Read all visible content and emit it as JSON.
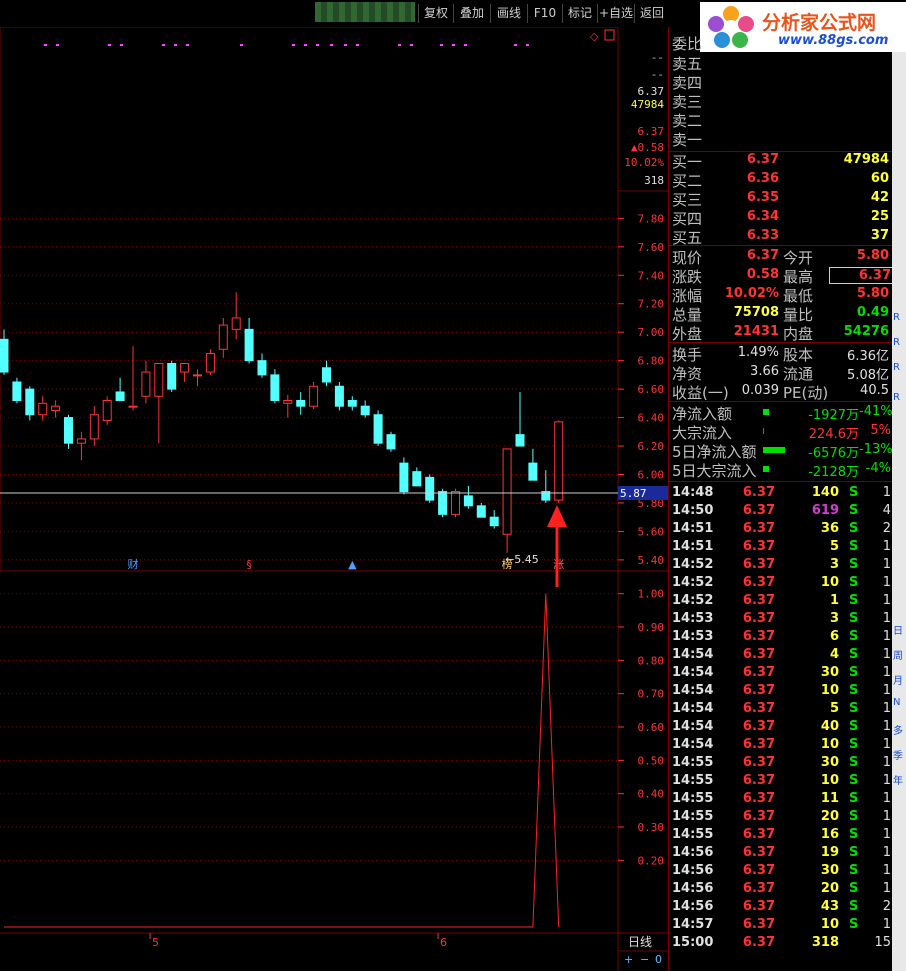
{
  "toolbar": {
    "buttons": [
      "复权",
      "叠加",
      "画线",
      "F10",
      "标记",
      "+自选",
      "返回"
    ]
  },
  "logo": {
    "title": "分析家公式网",
    "url": "www.88gs.com"
  },
  "chart_data": [
    {
      "type": "candlestick",
      "title": "",
      "ylim": [
        5.35,
        7.95
      ],
      "yticks": [
        "7.80",
        "7.60",
        "7.40",
        "7.20",
        "7.00",
        "6.80",
        "6.60",
        "6.40",
        "6.20",
        "6.00",
        "5.80",
        "5.60",
        "5.40"
      ],
      "current_line": "5.87",
      "low_marker": "←5.45",
      "candles": [
        {
          "o": 6.95,
          "h": 7.02,
          "l": 6.7,
          "c": 6.72
        },
        {
          "o": 6.65,
          "h": 6.68,
          "l": 6.5,
          "c": 6.52
        },
        {
          "o": 6.6,
          "h": 6.62,
          "l": 6.38,
          "c": 6.42
        },
        {
          "o": 6.42,
          "h": 6.55,
          "l": 6.38,
          "c": 6.5
        },
        {
          "o": 6.45,
          "h": 6.52,
          "l": 6.4,
          "c": 6.48
        },
        {
          "o": 6.4,
          "h": 6.42,
          "l": 6.18,
          "c": 6.22
        },
        {
          "o": 6.22,
          "h": 6.3,
          "l": 6.1,
          "c": 6.25
        },
        {
          "o": 6.25,
          "h": 6.48,
          "l": 6.2,
          "c": 6.42
        },
        {
          "o": 6.38,
          "h": 6.55,
          "l": 6.35,
          "c": 6.52
        },
        {
          "o": 6.58,
          "h": 6.68,
          "l": 6.52,
          "c": 6.52
        },
        {
          "o": 6.48,
          "h": 6.9,
          "l": 6.45,
          "c": 6.48
        },
        {
          "o": 6.55,
          "h": 6.8,
          "l": 6.5,
          "c": 6.72
        },
        {
          "o": 6.55,
          "h": 6.78,
          "l": 6.22,
          "c": 6.78
        },
        {
          "o": 6.78,
          "h": 6.8,
          "l": 6.58,
          "c": 6.6
        },
        {
          "o": 6.72,
          "h": 6.78,
          "l": 6.65,
          "c": 6.78
        },
        {
          "o": 6.7,
          "h": 6.74,
          "l": 6.62,
          "c": 6.7
        },
        {
          "o": 6.72,
          "h": 6.88,
          "l": 6.7,
          "c": 6.85
        },
        {
          "o": 6.88,
          "h": 7.1,
          "l": 6.82,
          "c": 7.05
        },
        {
          "o": 7.02,
          "h": 7.28,
          "l": 6.95,
          "c": 7.1
        },
        {
          "o": 7.02,
          "h": 7.1,
          "l": 6.78,
          "c": 6.8
        },
        {
          "o": 6.8,
          "h": 6.85,
          "l": 6.68,
          "c": 6.7
        },
        {
          "o": 6.7,
          "h": 6.74,
          "l": 6.5,
          "c": 6.52
        },
        {
          "o": 6.5,
          "h": 6.56,
          "l": 6.4,
          "c": 6.52
        },
        {
          "o": 6.52,
          "h": 6.58,
          "l": 6.42,
          "c": 6.48
        },
        {
          "o": 6.48,
          "h": 6.65,
          "l": 6.46,
          "c": 6.62
        },
        {
          "o": 6.75,
          "h": 6.8,
          "l": 6.62,
          "c": 6.65
        },
        {
          "o": 6.62,
          "h": 6.65,
          "l": 6.45,
          "c": 6.48
        },
        {
          "o": 6.52,
          "h": 6.55,
          "l": 6.45,
          "c": 6.48
        },
        {
          "o": 6.48,
          "h": 6.52,
          "l": 6.4,
          "c": 6.42
        },
        {
          "o": 6.42,
          "h": 6.45,
          "l": 6.2,
          "c": 6.22
        },
        {
          "o": 6.28,
          "h": 6.3,
          "l": 6.16,
          "c": 6.18
        },
        {
          "o": 6.08,
          "h": 6.12,
          "l": 5.86,
          "c": 5.88
        },
        {
          "o": 6.02,
          "h": 6.05,
          "l": 5.92,
          "c": 5.92
        },
        {
          "o": 5.98,
          "h": 6.0,
          "l": 5.8,
          "c": 5.82
        },
        {
          "o": 5.88,
          "h": 5.9,
          "l": 5.7,
          "c": 5.72
        },
        {
          "o": 5.72,
          "h": 5.9,
          "l": 5.7,
          "c": 5.88
        },
        {
          "o": 5.85,
          "h": 5.92,
          "l": 5.76,
          "c": 5.78
        },
        {
          "o": 5.78,
          "h": 5.8,
          "l": 5.7,
          "c": 5.7
        },
        {
          "o": 5.7,
          "h": 5.75,
          "l": 5.62,
          "c": 5.64
        },
        {
          "o": 5.58,
          "h": 6.18,
          "l": 5.45,
          "c": 6.18
        },
        {
          "o": 6.28,
          "h": 6.58,
          "l": 6.2,
          "c": 6.2
        },
        {
          "o": 6.08,
          "h": 6.18,
          "l": 5.96,
          "c": 5.96
        },
        {
          "o": 5.88,
          "h": 6.03,
          "l": 5.8,
          "c": 5.82
        },
        {
          "o": 5.82,
          "h": 6.38,
          "l": 5.8,
          "c": 6.37
        }
      ],
      "events": [
        {
          "label": "财",
          "index": 10,
          "color": "#4fa0ff"
        },
        {
          "label": "§",
          "index": 19,
          "color": "#ff3333"
        },
        {
          "label": "▲",
          "index": 27,
          "color": "#4fa0ff"
        },
        {
          "label": "榜",
          "index": 39,
          "color": "#ffcc66"
        },
        {
          "label": "涨",
          "index": 43,
          "color": "#ff6666"
        }
      ]
    },
    {
      "type": "line",
      "title": "",
      "ylim": [
        0,
        1.05
      ],
      "yticks": [
        "1.00",
        "0.90",
        "0.80",
        "0.70",
        "0.60",
        "0.50",
        "0.40",
        "0.30",
        "0.20"
      ],
      "values_note": "",
      "values": [
        0,
        0,
        0,
        0,
        0,
        0,
        0,
        0,
        0,
        0,
        0,
        0,
        0,
        0,
        0,
        0,
        0,
        0,
        0,
        0,
        0,
        0,
        0,
        0,
        0,
        0,
        0,
        0,
        0,
        0,
        0,
        0,
        0,
        0,
        0,
        0,
        0,
        0,
        0,
        0,
        0,
        0,
        1,
        0
      ],
      "x_labels": [
        "5",
        "6"
      ]
    }
  ],
  "right_axis_top": [
    "--",
    "--",
    "6.37",
    "47984",
    "6.37",
    "▲0.58",
    "10.02%",
    "318"
  ],
  "quote": {
    "labels": {
      "weibi": "委比",
      "sell": [
        "卖五",
        "卖四",
        "卖三",
        "卖二",
        "卖一"
      ],
      "buy": [
        "买一",
        "买二",
        "买三",
        "买四",
        "买五"
      ]
    },
    "buy_prices": [
      "6.37",
      "6.36",
      "6.35",
      "6.34",
      "6.33"
    ],
    "buy_vols": [
      "47984",
      "60",
      "42",
      "25",
      "37"
    ],
    "stats": [
      {
        "l1": "现价",
        "v1": "6.37",
        "l2": "今开",
        "v2": "5.80"
      },
      {
        "l1": "涨跌",
        "v1": "0.58",
        "l2": "最高",
        "v2": "6.37"
      },
      {
        "l1": "涨幅",
        "v1": "10.02%",
        "l2": "最低",
        "v2": "5.80"
      },
      {
        "l1": "总量",
        "v1": "75708",
        "l2": "量比",
        "v2": "0.49"
      },
      {
        "l1": "外盘",
        "v1": "21431",
        "l2": "内盘",
        "v2": "54276"
      }
    ],
    "stats2": [
      {
        "l1": "换手",
        "v1": "1.49%",
        "l2": "股本",
        "v2": "6.36亿"
      },
      {
        "l1": "净资",
        "v1": "3.66",
        "l2": "流通",
        "v2": "5.08亿"
      },
      {
        "l1": "收益(一)",
        "v1": "0.039",
        "l2": "PE(动)",
        "v2": "40.5"
      }
    ],
    "flows": [
      {
        "l": "净流入额",
        "v": "-1927万",
        "p": "-41%"
      },
      {
        "l": "大宗流入",
        "v": "224.6万",
        "p": "5%"
      },
      {
        "l": "5日净流入额",
        "v": "-6576万",
        "p": "-13%"
      },
      {
        "l": "5日大宗流入",
        "v": "-2128万",
        "p": "-4%"
      }
    ]
  },
  "ticks": [
    {
      "t": "14:48",
      "p": "6.37",
      "v": "140",
      "s": "S",
      "n": "1"
    },
    {
      "t": "14:50",
      "p": "6.37",
      "v": "619",
      "s": "S",
      "n": "4"
    },
    {
      "t": "14:51",
      "p": "6.37",
      "v": "36",
      "s": "S",
      "n": "2"
    },
    {
      "t": "14:51",
      "p": "6.37",
      "v": "5",
      "s": "S",
      "n": "1"
    },
    {
      "t": "14:52",
      "p": "6.37",
      "v": "3",
      "s": "S",
      "n": "1"
    },
    {
      "t": "14:52",
      "p": "6.37",
      "v": "10",
      "s": "S",
      "n": "1"
    },
    {
      "t": "14:52",
      "p": "6.37",
      "v": "1",
      "s": "S",
      "n": "1"
    },
    {
      "t": "14:53",
      "p": "6.37",
      "v": "3",
      "s": "S",
      "n": "1"
    },
    {
      "t": "14:53",
      "p": "6.37",
      "v": "6",
      "s": "S",
      "n": "1"
    },
    {
      "t": "14:54",
      "p": "6.37",
      "v": "4",
      "s": "S",
      "n": "1"
    },
    {
      "t": "14:54",
      "p": "6.37",
      "v": "30",
      "s": "S",
      "n": "1"
    },
    {
      "t": "14:54",
      "p": "6.37",
      "v": "10",
      "s": "S",
      "n": "1"
    },
    {
      "t": "14:54",
      "p": "6.37",
      "v": "5",
      "s": "S",
      "n": "1"
    },
    {
      "t": "14:54",
      "p": "6.37",
      "v": "40",
      "s": "S",
      "n": "1"
    },
    {
      "t": "14:54",
      "p": "6.37",
      "v": "10",
      "s": "S",
      "n": "1"
    },
    {
      "t": "14:55",
      "p": "6.37",
      "v": "30",
      "s": "S",
      "n": "1"
    },
    {
      "t": "14:55",
      "p": "6.37",
      "v": "10",
      "s": "S",
      "n": "1"
    },
    {
      "t": "14:55",
      "p": "6.37",
      "v": "11",
      "s": "S",
      "n": "1"
    },
    {
      "t": "14:55",
      "p": "6.37",
      "v": "20",
      "s": "S",
      "n": "1"
    },
    {
      "t": "14:55",
      "p": "6.37",
      "v": "16",
      "s": "S",
      "n": "1"
    },
    {
      "t": "14:56",
      "p": "6.37",
      "v": "19",
      "s": "S",
      "n": "1"
    },
    {
      "t": "14:56",
      "p": "6.37",
      "v": "30",
      "s": "S",
      "n": "1"
    },
    {
      "t": "14:56",
      "p": "6.37",
      "v": "20",
      "s": "S",
      "n": "1"
    },
    {
      "t": "14:56",
      "p": "6.37",
      "v": "43",
      "s": "S",
      "n": "2"
    },
    {
      "t": "14:57",
      "p": "6.37",
      "v": "10",
      "s": "S",
      "n": "1"
    },
    {
      "t": "15:00",
      "p": "6.37",
      "v": "318",
      "s": "",
      "n": "15"
    }
  ],
  "bottom": {
    "period": "日线",
    "plus": "+",
    "minus": "−",
    "zero": "0"
  },
  "sidebar": [
    "R",
    "R",
    "R",
    "R",
    "日",
    "周",
    "月",
    "N",
    "多",
    "季",
    "年"
  ],
  "colors": {
    "up": "#ff3333",
    "down": "#54ffff",
    "grid": "#7a0000",
    "bg": "#000000"
  }
}
